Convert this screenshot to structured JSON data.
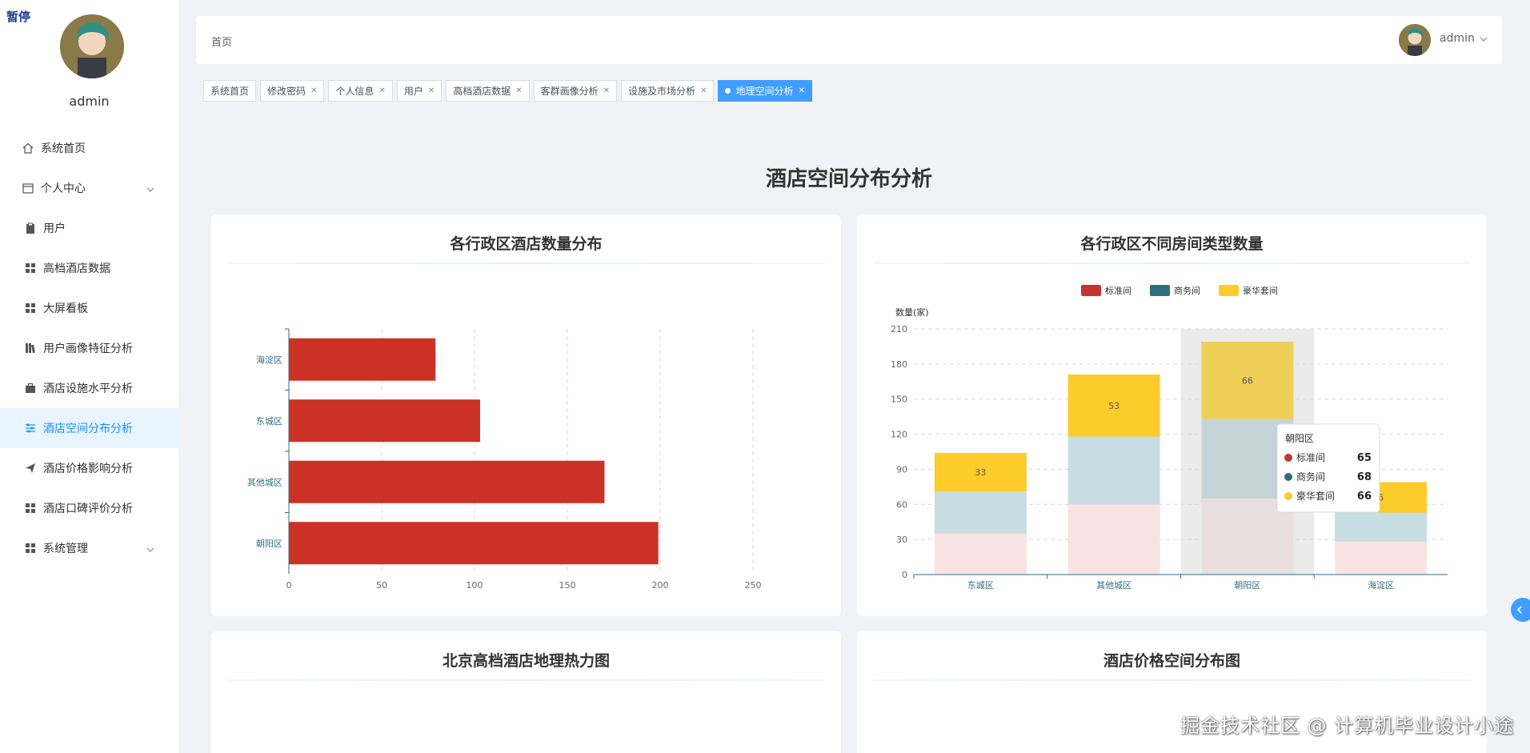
{
  "pause_label": "暂停",
  "sidebar": {
    "username": "admin",
    "items": [
      {
        "label": "系统首页",
        "icon": "home-icon",
        "kind": "top"
      },
      {
        "label": "个人中心",
        "icon": "calendar-icon",
        "kind": "top",
        "chevron": true
      },
      {
        "label": "用户",
        "icon": "clipboard-icon",
        "kind": "sub"
      },
      {
        "label": "高档酒店数据",
        "icon": "grid-icon",
        "kind": "sub"
      },
      {
        "label": "大屏看板",
        "icon": "grid-icon",
        "kind": "sub"
      },
      {
        "label": "用户画像特征分析",
        "icon": "books-icon",
        "kind": "sub"
      },
      {
        "label": "酒店设施水平分析",
        "icon": "briefcase-icon",
        "kind": "sub"
      },
      {
        "label": "酒店空间分布分析",
        "icon": "sliders-icon",
        "kind": "sub",
        "active": true
      },
      {
        "label": "酒店价格影响分析",
        "icon": "send-icon",
        "kind": "sub"
      },
      {
        "label": "酒店口碑评价分析",
        "icon": "grid-icon",
        "kind": "sub"
      },
      {
        "label": "系统管理",
        "icon": "grid-icon",
        "kind": "sub",
        "chevron": true
      }
    ]
  },
  "header": {
    "breadcrumb": "首页",
    "username": "admin"
  },
  "tags": [
    {
      "label": "系统首页",
      "closable": false
    },
    {
      "label": "修改密码",
      "closable": true
    },
    {
      "label": "个人信息",
      "closable": true
    },
    {
      "label": "用户",
      "closable": true
    },
    {
      "label": "高档酒店数据",
      "closable": true
    },
    {
      "label": "客群画像分析",
      "closable": true
    },
    {
      "label": "设施及市场分析",
      "closable": true
    },
    {
      "label": "地理空间分析",
      "closable": true,
      "active": true
    }
  ],
  "page_title": "酒店空间分布分析",
  "cards": {
    "hotel_count_title": "各行政区酒店数量分布",
    "room_type_title": "各行政区不同房间类型数量",
    "heatmap_title": "北京高档酒店地理热力图",
    "price_map_title": "酒店价格空间分布图"
  },
  "chart_data": [
    {
      "type": "bar",
      "orientation": "horizontal",
      "title": "各行政区酒店数量分布",
      "categories": [
        "海淀区",
        "东城区",
        "其他城区",
        "朝阳区"
      ],
      "values": [
        79,
        103,
        170,
        199
      ],
      "xlim": [
        0,
        250
      ],
      "xticks": [
        0,
        50,
        100,
        150,
        200,
        250
      ],
      "color": "#cc3126",
      "grid": true
    },
    {
      "type": "bar",
      "stacked": true,
      "title": "各行政区不同房间类型数量",
      "ylabel": "数量(家)",
      "categories": [
        "东城区",
        "其他城区",
        "朝阳区",
        "海淀区"
      ],
      "ylim": [
        0,
        210
      ],
      "yticks": [
        0,
        30,
        60,
        90,
        120,
        150,
        180,
        210
      ],
      "legend_position": "top-center",
      "series": [
        {
          "name": "标准间",
          "color": "#c23531",
          "values": [
            35,
            60,
            65,
            28
          ]
        },
        {
          "name": "商务间",
          "color": "#2f6e7f",
          "values": [
            36,
            58,
            68,
            25
          ]
        },
        {
          "name": "豪华套间",
          "color": "#fdcb2a",
          "values": [
            33,
            53,
            66,
            26
          ]
        }
      ],
      "data_labels": [
        "33",
        "53",
        "66",
        "6"
      ],
      "tooltip": {
        "title": "朝阳区",
        "rows": [
          {
            "name": "标准间",
            "value": "65",
            "color": "#c23531"
          },
          {
            "name": "商务间",
            "value": "68",
            "color": "#2f6e7f"
          },
          {
            "name": "豪华套间",
            "value": "66",
            "color": "#fdcb2a"
          }
        ]
      },
      "highlighted_category": "朝阳区"
    }
  ],
  "watermark": "掘金技术社区 @ 计算机毕业设计小途"
}
